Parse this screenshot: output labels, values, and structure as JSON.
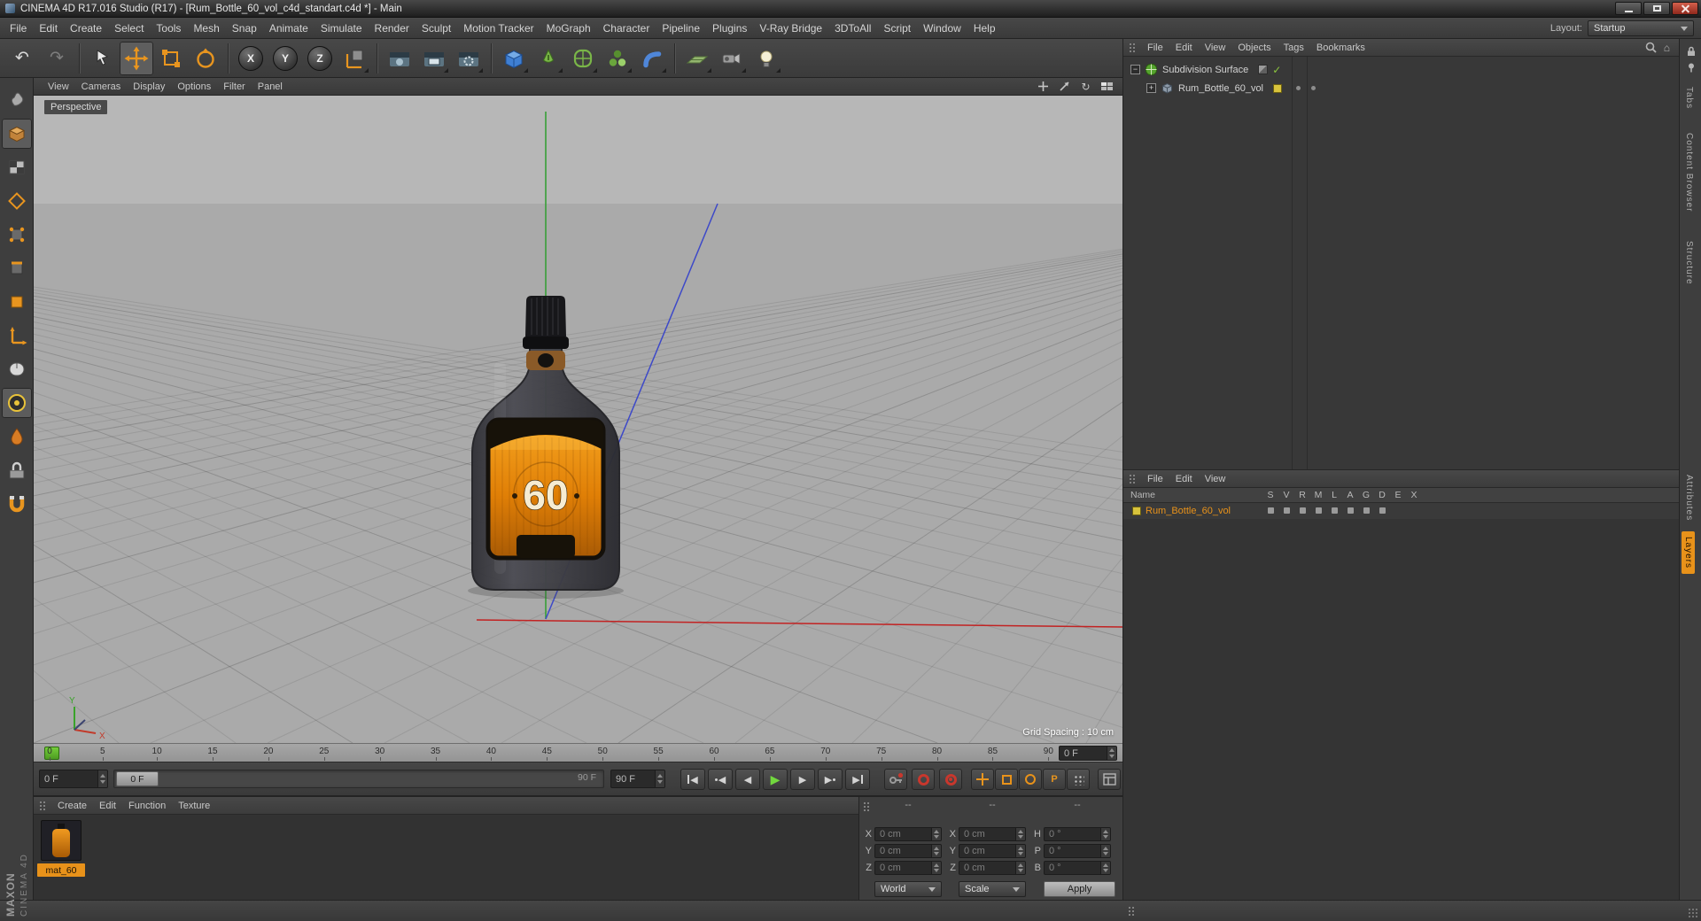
{
  "window": {
    "title": "CINEMA 4D R17.016 Studio (R17) - [Rum_Bottle_60_vol_c4d_standart.c4d *] - Main"
  },
  "menubar": {
    "items": [
      "File",
      "Edit",
      "Create",
      "Select",
      "Tools",
      "Mesh",
      "Snap",
      "Animate",
      "Simulate",
      "Render",
      "Sculpt",
      "Motion Tracker",
      "MoGraph",
      "Character",
      "Pipeline",
      "Plugins",
      "V-Ray Bridge",
      "3DToAll",
      "Script",
      "Window",
      "Help"
    ]
  },
  "layout": {
    "label": "Layout:",
    "value": "Startup"
  },
  "toolbar": {
    "axis_locks": [
      "X",
      "Y",
      "Z"
    ]
  },
  "viewport": {
    "menu": [
      "View",
      "Cameras",
      "Display",
      "Options",
      "Filter",
      "Panel"
    ],
    "camera_label": "Perspective",
    "grid_spacing": "Grid Spacing : 10 cm",
    "axis_x": "X",
    "axis_y": "Y"
  },
  "bottle": {
    "label": "60"
  },
  "timeline": {
    "ticks": [
      "0",
      "5",
      "10",
      "15",
      "20",
      "25",
      "30",
      "35",
      "40",
      "45",
      "50",
      "55",
      "60",
      "65",
      "70",
      "75",
      "80",
      "85",
      "90"
    ],
    "frame_field": "0 F"
  },
  "transport": {
    "current": "0 F",
    "handle": "0 F",
    "range_end": "90 F",
    "end_field": "90 F",
    "parameter_key": "P"
  },
  "materials": {
    "menu": [
      "Create",
      "Edit",
      "Function",
      "Texture"
    ],
    "items": [
      {
        "name": "mat_60"
      }
    ]
  },
  "coordinates": {
    "position": {
      "header": "--",
      "rows": [
        {
          "label": "X",
          "value": "0 cm"
        },
        {
          "label": "Y",
          "value": "0 cm"
        },
        {
          "label": "Z",
          "value": "0 cm"
        }
      ],
      "mode": "World"
    },
    "size": {
      "header": "--",
      "rows": [
        {
          "label": "X",
          "value": "0 cm"
        },
        {
          "label": "Y",
          "value": "0 cm"
        },
        {
          "label": "Z",
          "value": "0 cm"
        }
      ],
      "mode": "Scale"
    },
    "rotation": {
      "header": "--",
      "rows": [
        {
          "label": "H",
          "value": "0 °"
        },
        {
          "label": "P",
          "value": "0 °"
        },
        {
          "label": "B",
          "value": "0 °"
        }
      ]
    },
    "apply": "Apply"
  },
  "object_manager": {
    "menu": [
      "File",
      "Edit",
      "View",
      "Objects",
      "Tags",
      "Bookmarks"
    ],
    "objects": [
      {
        "name": "Subdivision Surface"
      },
      {
        "name": "Rum_Bottle_60_vol"
      }
    ]
  },
  "layer_manager": {
    "menu": [
      "File",
      "Edit",
      "View"
    ],
    "name_header": "Name",
    "columns": [
      "S",
      "V",
      "R",
      "M",
      "L",
      "A",
      "G",
      "D",
      "E",
      "X"
    ],
    "rows": [
      {
        "name": "Rum_Bottle_60_vol"
      }
    ]
  },
  "right_tabs": {
    "top": [
      "Tabs",
      "Content Browser",
      "Structure"
    ],
    "bottom": [
      "Attributes",
      "Layers"
    ]
  },
  "branding": {
    "maxon": "MAXON",
    "cinema": "CINEMA 4D"
  },
  "colors": {
    "accent": "#e8921a",
    "play_green": "#72d83e",
    "record_red": "#c8372d",
    "layer_yellow": "#d8c33c"
  }
}
